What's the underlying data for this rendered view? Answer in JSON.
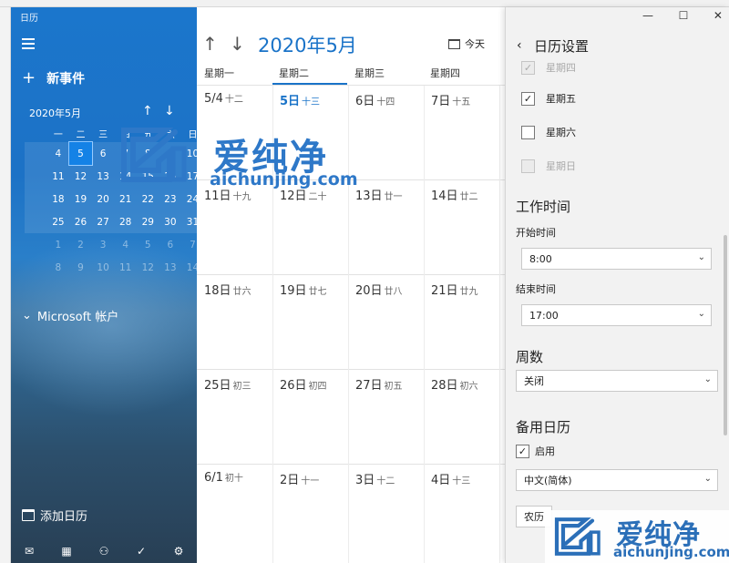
{
  "left": {
    "app_title": "日历",
    "new_event": "新事件",
    "mini_month": "2020年5月",
    "mini_weekdays": [
      "一",
      "二",
      "三",
      "四",
      "五",
      "六",
      "日"
    ],
    "mini_weeks": [
      [
        "4",
        "5",
        "6",
        "7",
        "8",
        "9",
        "10"
      ],
      [
        "11",
        "12",
        "13",
        "14",
        "15",
        "16",
        "17"
      ],
      [
        "18",
        "19",
        "20",
        "21",
        "22",
        "23",
        "24"
      ],
      [
        "25",
        "26",
        "27",
        "28",
        "29",
        "30",
        "31"
      ],
      [
        "1",
        "2",
        "3",
        "4",
        "5",
        "6",
        "7"
      ],
      [
        "8",
        "9",
        "10",
        "11",
        "12",
        "13",
        "14"
      ]
    ],
    "selected_day": "5",
    "account": "Microsoft 帐户",
    "add_calendar": "添加日历"
  },
  "main": {
    "month_title": "2020年5月",
    "today": "今天",
    "weekdays": [
      "星期一",
      "星期二",
      "星期三",
      "星期四"
    ],
    "rows": [
      [
        [
          "5/4",
          "十二"
        ],
        [
          "5日",
          "十三"
        ],
        [
          "6日",
          "十四"
        ],
        [
          "7日",
          "十五"
        ]
      ],
      [
        [
          "11日",
          "十九"
        ],
        [
          "12日",
          "二十"
        ],
        [
          "13日",
          "廿一"
        ],
        [
          "14日",
          "廿二"
        ]
      ],
      [
        [
          "18日",
          "廿六"
        ],
        [
          "19日",
          "廿七"
        ],
        [
          "20日",
          "廿八"
        ],
        [
          "21日",
          "廿九"
        ]
      ],
      [
        [
          "25日",
          "初三"
        ],
        [
          "26日",
          "初四"
        ],
        [
          "27日",
          "初五"
        ],
        [
          "28日",
          "初六"
        ]
      ],
      [
        [
          "6/1",
          "初十"
        ],
        [
          "2日",
          "十一"
        ],
        [
          "3日",
          "十二"
        ],
        [
          "4日",
          "十三"
        ]
      ]
    ]
  },
  "settings": {
    "title": "日历设置",
    "days": [
      {
        "label": "星期四",
        "checked": true,
        "disabled": true
      },
      {
        "label": "星期五",
        "checked": true,
        "disabled": false
      },
      {
        "label": "星期六",
        "checked": false,
        "disabled": false
      },
      {
        "label": "星期日",
        "checked": false,
        "disabled": true
      }
    ],
    "work_hours": "工作时间",
    "start_label": "开始时间",
    "start_value": "8:00",
    "end_label": "结束时间",
    "end_value": "17:00",
    "week_num": "周数",
    "week_num_value": "关闭",
    "alt_cal": "备用日历",
    "enable_label": "启用",
    "language_value": "中文(简体)",
    "type_value": "农历"
  },
  "watermark": {
    "brand": "爱纯净",
    "url": "aichunjing.com"
  },
  "colors": {
    "accent": "#1a73c8",
    "left_pane": "#1c72c6",
    "settings_bg": "#f2f2f2"
  }
}
